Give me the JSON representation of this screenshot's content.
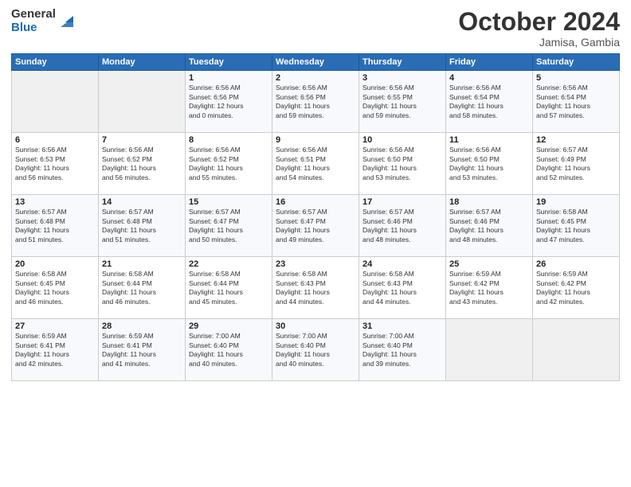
{
  "header": {
    "title": "October 2024",
    "location": "Jamisa, Gambia"
  },
  "columns": [
    "Sunday",
    "Monday",
    "Tuesday",
    "Wednesday",
    "Thursday",
    "Friday",
    "Saturday"
  ],
  "weeks": [
    [
      {
        "day": "",
        "info": ""
      },
      {
        "day": "",
        "info": ""
      },
      {
        "day": "1",
        "info": "Sunrise: 6:56 AM\nSunset: 6:56 PM\nDaylight: 12 hours\nand 0 minutes."
      },
      {
        "day": "2",
        "info": "Sunrise: 6:56 AM\nSunset: 6:56 PM\nDaylight: 11 hours\nand 59 minutes."
      },
      {
        "day": "3",
        "info": "Sunrise: 6:56 AM\nSunset: 6:55 PM\nDaylight: 11 hours\nand 59 minutes."
      },
      {
        "day": "4",
        "info": "Sunrise: 6:56 AM\nSunset: 6:54 PM\nDaylight: 11 hours\nand 58 minutes."
      },
      {
        "day": "5",
        "info": "Sunrise: 6:56 AM\nSunset: 6:54 PM\nDaylight: 11 hours\nand 57 minutes."
      }
    ],
    [
      {
        "day": "6",
        "info": "Sunrise: 6:56 AM\nSunset: 6:53 PM\nDaylight: 11 hours\nand 56 minutes."
      },
      {
        "day": "7",
        "info": "Sunrise: 6:56 AM\nSunset: 6:52 PM\nDaylight: 11 hours\nand 56 minutes."
      },
      {
        "day": "8",
        "info": "Sunrise: 6:56 AM\nSunset: 6:52 PM\nDaylight: 11 hours\nand 55 minutes."
      },
      {
        "day": "9",
        "info": "Sunrise: 6:56 AM\nSunset: 6:51 PM\nDaylight: 11 hours\nand 54 minutes."
      },
      {
        "day": "10",
        "info": "Sunrise: 6:56 AM\nSunset: 6:50 PM\nDaylight: 11 hours\nand 53 minutes."
      },
      {
        "day": "11",
        "info": "Sunrise: 6:56 AM\nSunset: 6:50 PM\nDaylight: 11 hours\nand 53 minutes."
      },
      {
        "day": "12",
        "info": "Sunrise: 6:57 AM\nSunset: 6:49 PM\nDaylight: 11 hours\nand 52 minutes."
      }
    ],
    [
      {
        "day": "13",
        "info": "Sunrise: 6:57 AM\nSunset: 6:48 PM\nDaylight: 11 hours\nand 51 minutes."
      },
      {
        "day": "14",
        "info": "Sunrise: 6:57 AM\nSunset: 6:48 PM\nDaylight: 11 hours\nand 51 minutes."
      },
      {
        "day": "15",
        "info": "Sunrise: 6:57 AM\nSunset: 6:47 PM\nDaylight: 11 hours\nand 50 minutes."
      },
      {
        "day": "16",
        "info": "Sunrise: 6:57 AM\nSunset: 6:47 PM\nDaylight: 11 hours\nand 49 minutes."
      },
      {
        "day": "17",
        "info": "Sunrise: 6:57 AM\nSunset: 6:46 PM\nDaylight: 11 hours\nand 48 minutes."
      },
      {
        "day": "18",
        "info": "Sunrise: 6:57 AM\nSunset: 6:46 PM\nDaylight: 11 hours\nand 48 minutes."
      },
      {
        "day": "19",
        "info": "Sunrise: 6:58 AM\nSunset: 6:45 PM\nDaylight: 11 hours\nand 47 minutes."
      }
    ],
    [
      {
        "day": "20",
        "info": "Sunrise: 6:58 AM\nSunset: 6:45 PM\nDaylight: 11 hours\nand 46 minutes."
      },
      {
        "day": "21",
        "info": "Sunrise: 6:58 AM\nSunset: 6:44 PM\nDaylight: 11 hours\nand 46 minutes."
      },
      {
        "day": "22",
        "info": "Sunrise: 6:58 AM\nSunset: 6:44 PM\nDaylight: 11 hours\nand 45 minutes."
      },
      {
        "day": "23",
        "info": "Sunrise: 6:58 AM\nSunset: 6:43 PM\nDaylight: 11 hours\nand 44 minutes."
      },
      {
        "day": "24",
        "info": "Sunrise: 6:58 AM\nSunset: 6:43 PM\nDaylight: 11 hours\nand 44 minutes."
      },
      {
        "day": "25",
        "info": "Sunrise: 6:59 AM\nSunset: 6:42 PM\nDaylight: 11 hours\nand 43 minutes."
      },
      {
        "day": "26",
        "info": "Sunrise: 6:59 AM\nSunset: 6:42 PM\nDaylight: 11 hours\nand 42 minutes."
      }
    ],
    [
      {
        "day": "27",
        "info": "Sunrise: 6:59 AM\nSunset: 6:41 PM\nDaylight: 11 hours\nand 42 minutes."
      },
      {
        "day": "28",
        "info": "Sunrise: 6:59 AM\nSunset: 6:41 PM\nDaylight: 11 hours\nand 41 minutes."
      },
      {
        "day": "29",
        "info": "Sunrise: 7:00 AM\nSunset: 6:40 PM\nDaylight: 11 hours\nand 40 minutes."
      },
      {
        "day": "30",
        "info": "Sunrise: 7:00 AM\nSunset: 6:40 PM\nDaylight: 11 hours\nand 40 minutes."
      },
      {
        "day": "31",
        "info": "Sunrise: 7:00 AM\nSunset: 6:40 PM\nDaylight: 11 hours\nand 39 minutes."
      },
      {
        "day": "",
        "info": ""
      },
      {
        "day": "",
        "info": ""
      }
    ]
  ]
}
